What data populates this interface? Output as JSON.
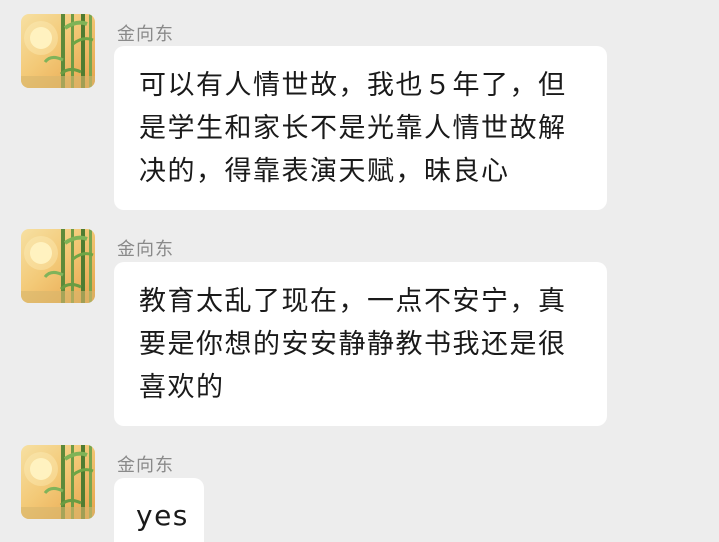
{
  "conversation": {
    "messages": [
      {
        "sender": "金向东",
        "lines": [
          "可以有人情世故，我也５年了，但",
          "是学生和家长不是光靠人情世故解",
          "决的，得靠表演天赋，昧良心"
        ]
      },
      {
        "sender": "金向东",
        "lines": [
          "教育太乱了现在，一点不安宁，真",
          "要是你想的安安静静教书我还是很",
          "喜欢的"
        ]
      },
      {
        "sender": "金向东",
        "lines": [
          "yes"
        ]
      }
    ]
  },
  "icons": {
    "avatar": "bamboo-sun-avatar-icon"
  },
  "colors": {
    "background": "#ededed",
    "bubble": "#ffffff",
    "sender_text": "#8a8a8a",
    "message_text": "#1a1a1a"
  }
}
